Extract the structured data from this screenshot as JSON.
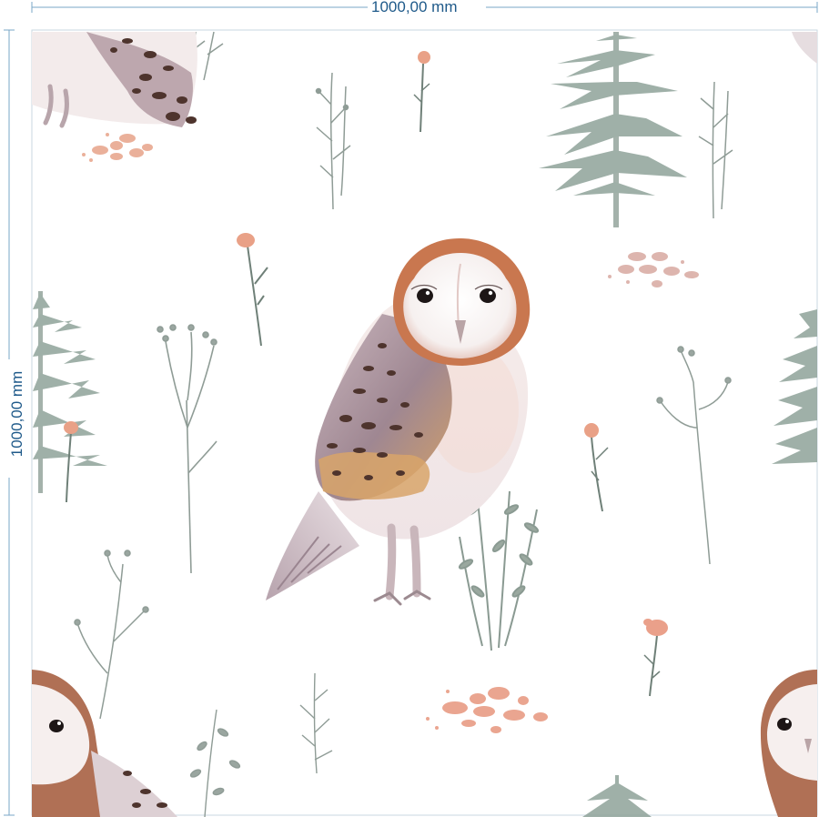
{
  "dimensions": {
    "width_label": "1000,00 mm",
    "height_label": "1000,00 mm",
    "line_color": "#7aa7c7",
    "text_color": "#1f5a8a"
  },
  "pattern": {
    "subject": "watercolor barn owl pattern",
    "palette": {
      "owl_rust": "#c9774f",
      "owl_cream": "#f7f1ee",
      "owl_brown": "#5a3d35",
      "owl_ochre": "#d4a066",
      "owl_lilac": "#b8a6ad",
      "tree_sage": "#8fa39a",
      "stem_grey": "#8f9c96",
      "flower_peach": "#e9a187",
      "pebble_peach": "#e8b6a2"
    }
  }
}
